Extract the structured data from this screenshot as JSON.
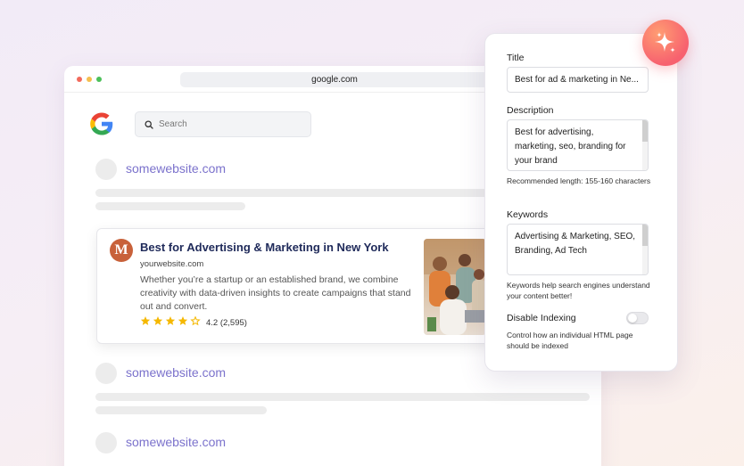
{
  "browser": {
    "url": "google.com"
  },
  "search": {
    "placeholder": "Search"
  },
  "results": [
    {
      "site": "somewebsite.com"
    },
    {
      "site": "somewebsite.com"
    },
    {
      "site": "somewebsite.com"
    }
  ],
  "featured": {
    "logo_letter": "M",
    "title": "Best for Advertising & Marketing in New York",
    "url": "yourwebsite.com",
    "description": "Whether you’re a startup or an established brand, we combine creativity with data-driven insights to create campaigns that stand out and convert.",
    "rating_value": 4.2,
    "rating_text": "4.2 (2,595)"
  },
  "seo_panel": {
    "title_label": "Title",
    "title_value": "Best for ad & marketing in Ne...",
    "description_label": "Description",
    "description_value": "Best for advertising, marketing, seo, branding for your brand",
    "description_help": "Recommended length: 155-160 characters",
    "keywords_label": "Keywords",
    "keywords_value": "Advertising & Marketing, SEO, Branding, Ad Tech",
    "keywords_help": "Keywords help search engines understand your content better!",
    "disable_indexing_label": "Disable Indexing",
    "disable_indexing_on": false,
    "disable_indexing_help": "Control how an individual HTML page should be indexed"
  },
  "colors": {
    "accent_link": "#7b72cc",
    "title_navy": "#1f2a5a",
    "star": "#f5b800",
    "sparkle_gradient": [
      "#ff9d72",
      "#f7616f"
    ]
  },
  "icons": [
    "google-logo-icon",
    "search-icon",
    "star-icon",
    "sparkle-icon"
  ]
}
